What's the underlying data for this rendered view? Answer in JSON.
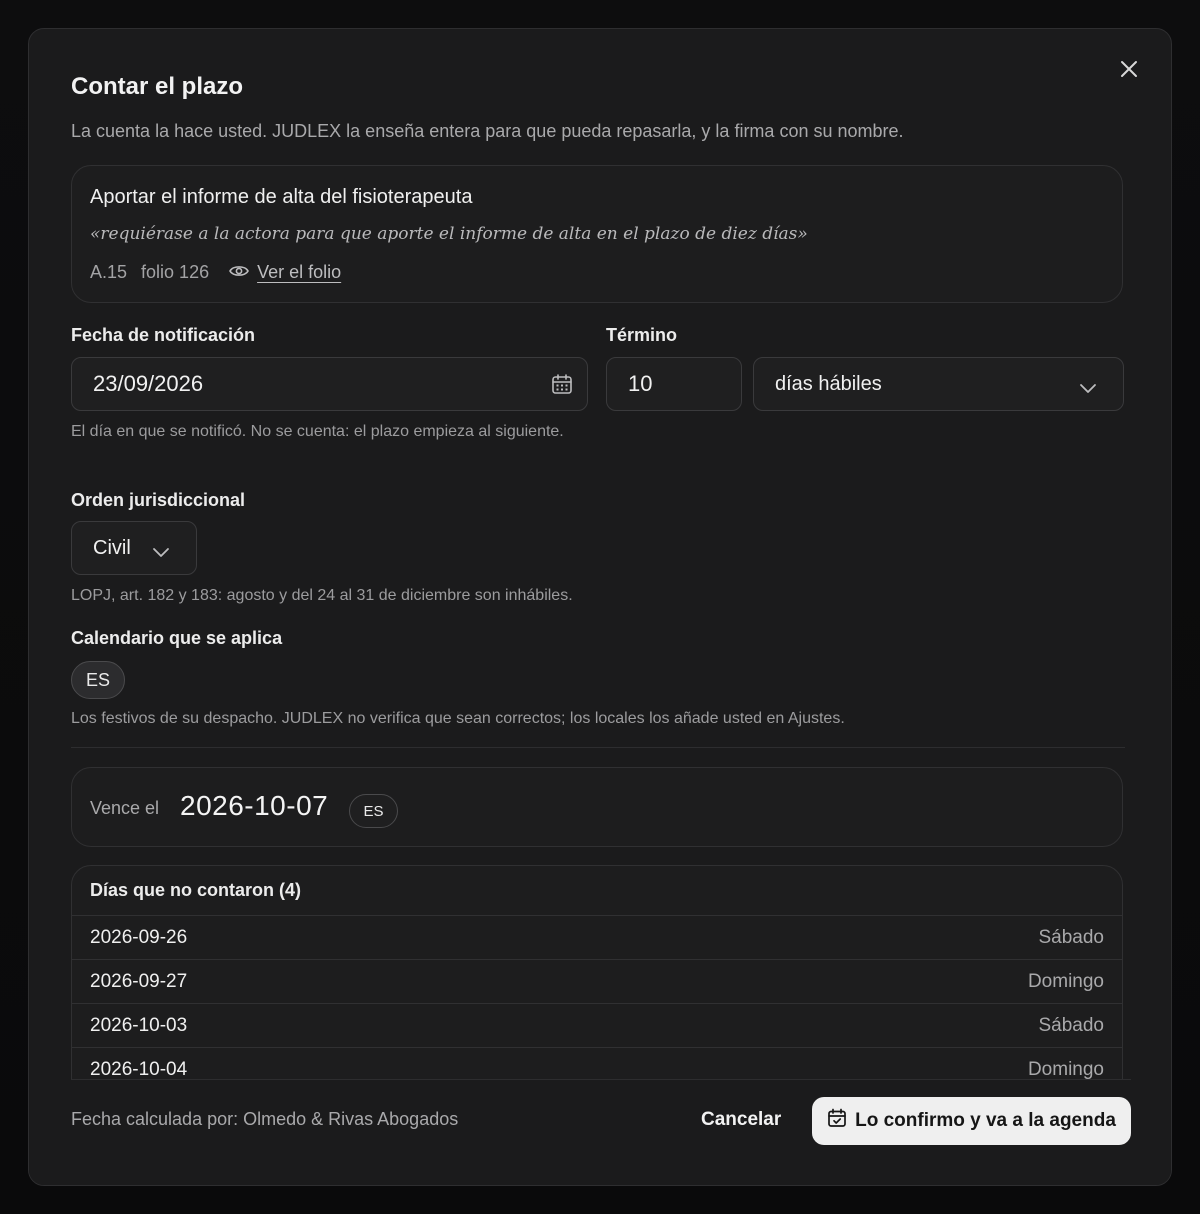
{
  "dialog": {
    "title": "Contar el plazo",
    "subtitle": "La cuenta la hace usted. JUDLEX la enseña entera para que pueda repasarla, y la firma con su nombre."
  },
  "task": {
    "title": "Aportar el informe de alta del fisioterapeuta",
    "quote": "«requiérase a la actora para que aporte el informe de alta en el plazo de diez días»",
    "ref": "A.15",
    "folio": "folio 126",
    "view_link": "Ver el folio"
  },
  "notification": {
    "label": "Fecha de notificación",
    "value": "23/09/2026",
    "help": "El día en que se notificó. No se cuenta: el plazo empieza al siguiente."
  },
  "term": {
    "label": "Término",
    "value": "10",
    "unit": "días hábiles"
  },
  "jurisdiction": {
    "label": "Orden jurisdiccional",
    "value": "Civil",
    "help": "LOPJ, art. 182 y 183: agosto y del 24 al 31 de diciembre son inhábiles."
  },
  "calendar": {
    "label": "Calendario que se aplica",
    "chip": "ES",
    "help": "Los festivos de su despacho. JUDLEX no verifica que sean correctos; los locales los añade usted en Ajustes."
  },
  "result": {
    "label": "Vence el",
    "date": "2026-10-07",
    "calendar": "ES"
  },
  "skipped": {
    "title": "Días que no contaron (4)",
    "rows": [
      {
        "date": "2026-09-26",
        "weekday": "Sábado"
      },
      {
        "date": "2026-09-27",
        "weekday": "Domingo"
      },
      {
        "date": "2026-10-03",
        "weekday": "Sábado"
      },
      {
        "date": "2026-10-04",
        "weekday": "Domingo"
      }
    ]
  },
  "footer": {
    "note": "Fecha calculada por: Olmedo & Rivas Abogados",
    "cancel": "Cancelar",
    "confirm": "Lo confirmo y va a la agenda"
  },
  "icons": [
    "close-icon",
    "eye-icon",
    "calendar-icon",
    "chevron-down-icon",
    "calendar-check-icon"
  ]
}
